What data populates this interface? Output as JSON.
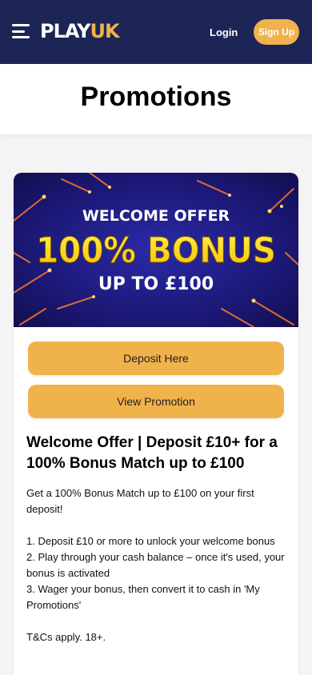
{
  "header": {
    "logo_part1": "PLAY",
    "logo_part2": "UK",
    "login_label": "Login",
    "signup_label": "Sign Up",
    "colors": {
      "background": "#1d2456",
      "accent": "#f0b24b"
    }
  },
  "page": {
    "title": "Promotions"
  },
  "promo": {
    "banner": {
      "line1": "WELCOME OFFER",
      "line2": "100% BONUS",
      "line3": "UP TO £100"
    },
    "deposit_label": "Deposit Here",
    "view_label": "View Promotion",
    "heading": "Welcome Offer | Deposit £10+ for a 100% Bonus Match up to £100",
    "intro": "Get a 100% Bonus Match up to £100 on your first deposit!",
    "steps": [
      "1. Deposit £10 or more to unlock your welcome bonus",
      "2. Play through your cash balance – once it's used, your bonus is activated",
      "3. Wager your bonus, then convert it to cash in 'My Promotions'"
    ],
    "terms": "T&Cs apply. 18+."
  }
}
